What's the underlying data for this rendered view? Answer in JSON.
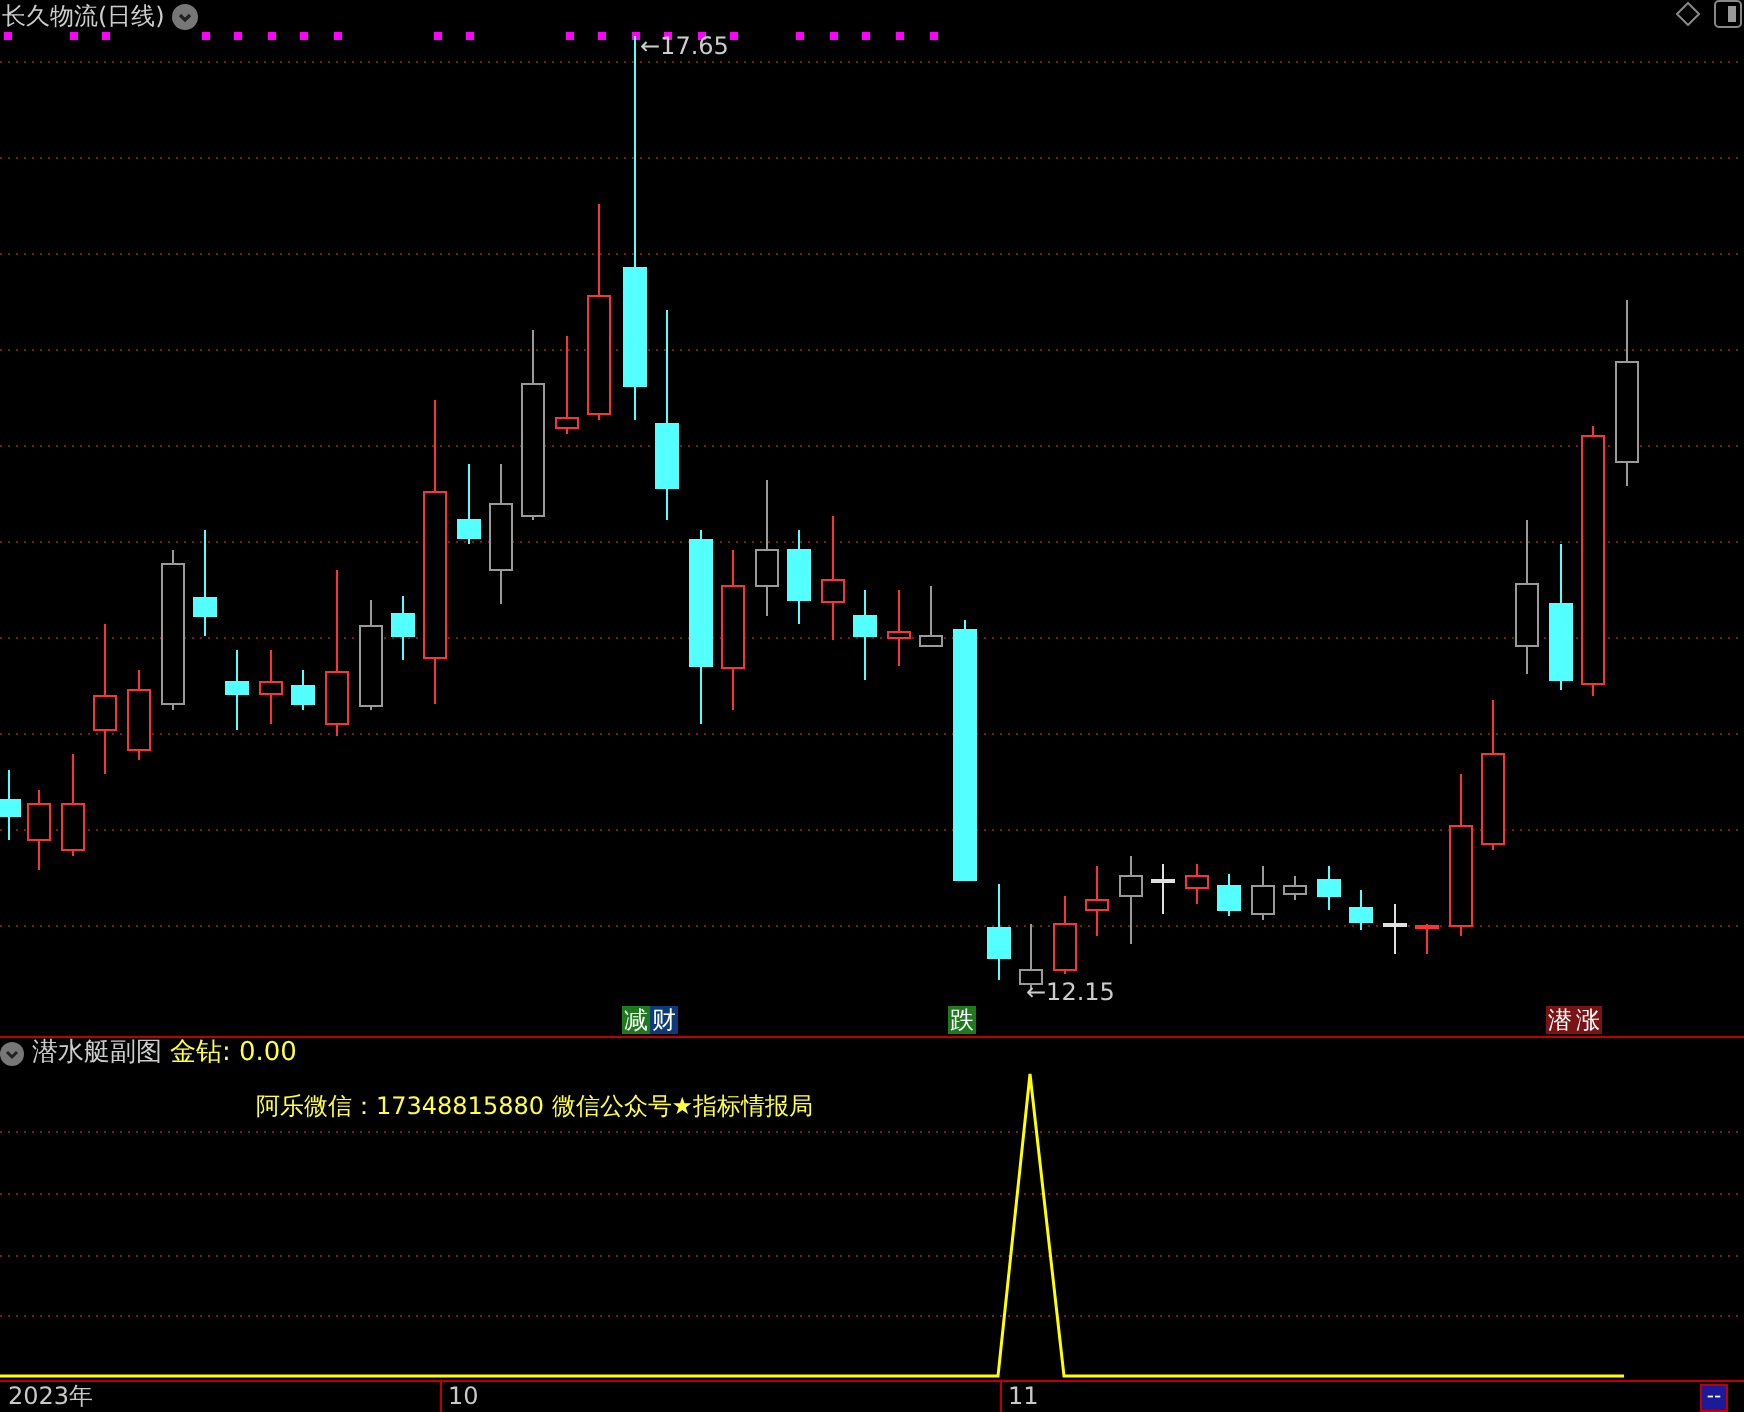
{
  "title": "长久物流(日线)",
  "price_labels": [
    {
      "kind": "high",
      "text": "←17.65"
    },
    {
      "kind": "low",
      "text": "←12.15"
    }
  ],
  "signals": [
    {
      "text": "减",
      "color": "#1f7a1f"
    },
    {
      "text": "财",
      "color": "#0d3b7a"
    },
    {
      "text": "跌",
      "color": "#1f7a1f"
    },
    {
      "text": "潜",
      "color": "#7a1414"
    },
    {
      "text": "涨",
      "color": "#7a1414"
    }
  ],
  "sub_chart": {
    "title": "潜水艇副图",
    "reading": "金钻: 0.00",
    "note": "阿乐微信：17348815880  微信公众号★指标情报局"
  },
  "axis": {
    "labels": [
      "2023年",
      "10",
      "11"
    ],
    "corner": "--"
  }
}
